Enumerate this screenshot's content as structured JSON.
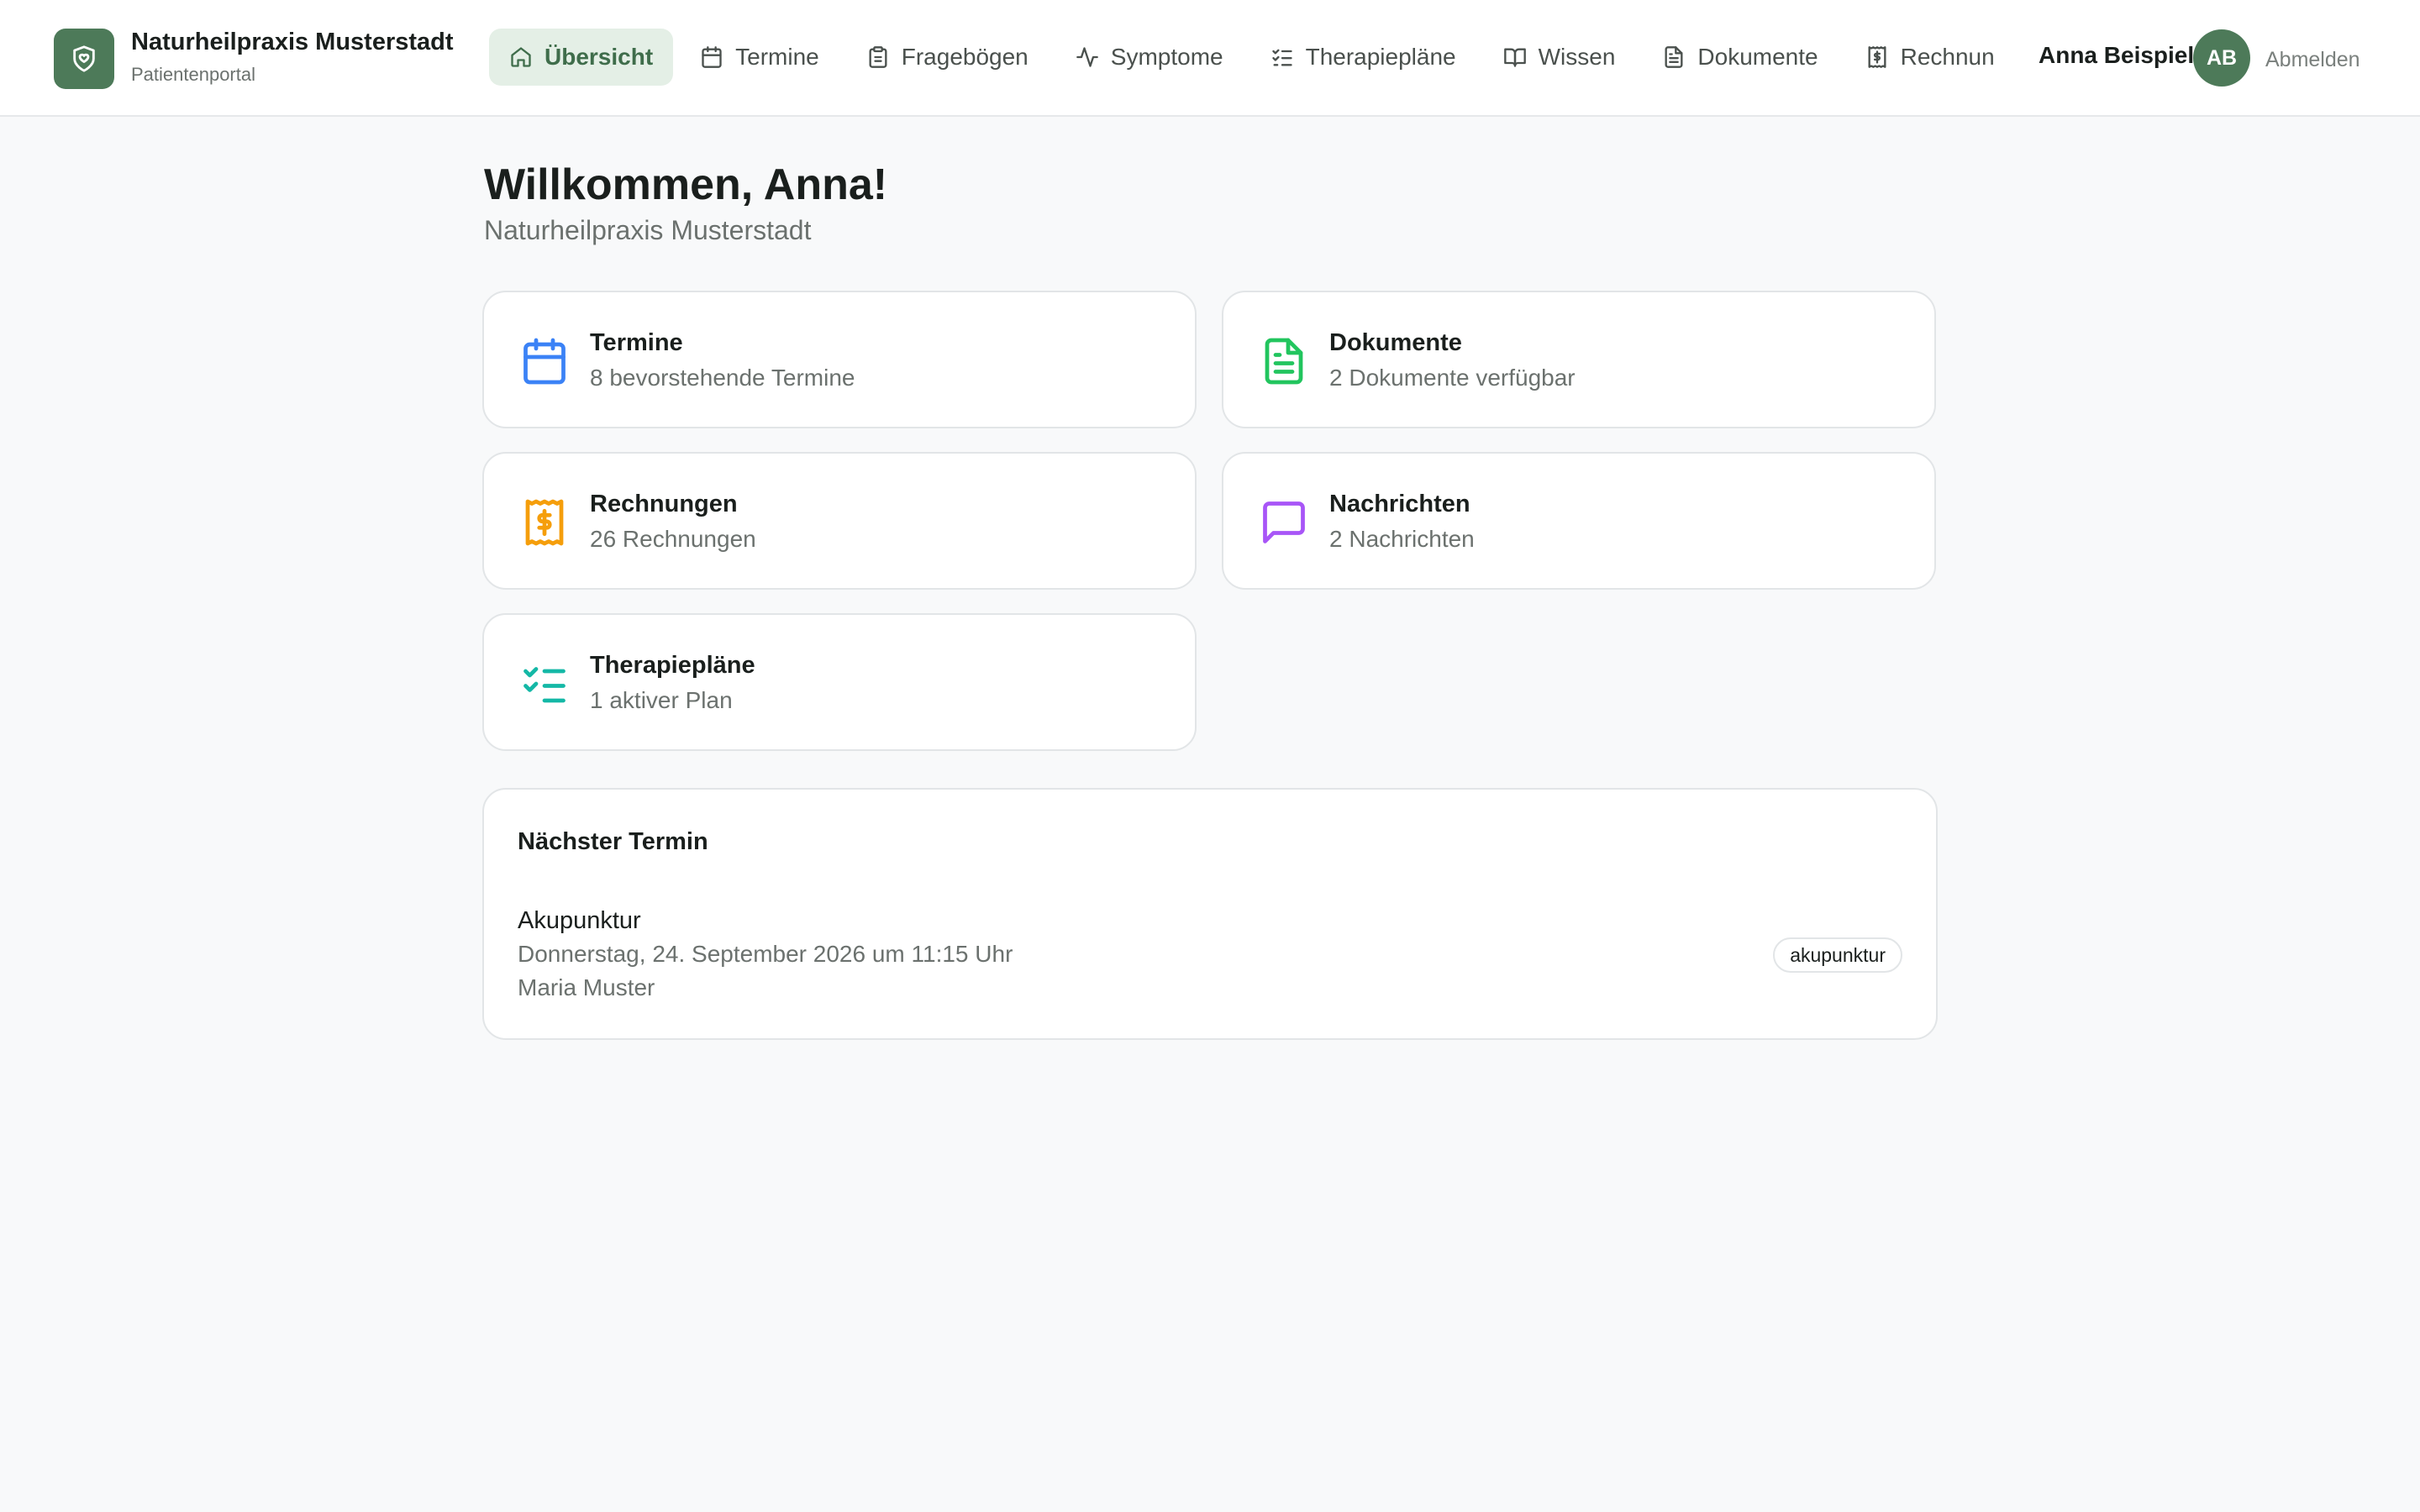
{
  "brand": {
    "name": "Naturheilpraxis Musterstadt",
    "subtitle": "Patientenportal"
  },
  "nav": {
    "items": [
      {
        "label": "Übersicht",
        "icon": "home-icon",
        "active": true
      },
      {
        "label": "Termine",
        "icon": "calendar-icon"
      },
      {
        "label": "Fragebögen",
        "icon": "clipboard-icon"
      },
      {
        "label": "Symptome",
        "icon": "activity-icon"
      },
      {
        "label": "Therapiepläne",
        "icon": "list-check-icon"
      },
      {
        "label": "Wissen",
        "icon": "book-open-icon"
      },
      {
        "label": "Dokumente",
        "icon": "file-text-icon"
      },
      {
        "label": "Rechnungen",
        "icon": "receipt-icon"
      }
    ]
  },
  "user": {
    "name": "Anna Beispiel",
    "initials": "AB",
    "logout_label": "Abmelden"
  },
  "main": {
    "welcome": "Willkommen, Anna!",
    "practice": "Naturheilpraxis Musterstadt",
    "cards": [
      {
        "title": "Termine",
        "subtitle": "8 bevorstehende Termine",
        "icon": "calendar-icon",
        "color": "#3b82f6"
      },
      {
        "title": "Dokumente",
        "subtitle": "2 Dokumente verfügbar",
        "icon": "file-text-icon",
        "color": "#22c55e"
      },
      {
        "title": "Rechnungen",
        "subtitle": "26 Rechnungen",
        "icon": "receipt-icon",
        "color": "#f59e0b"
      },
      {
        "title": "Nachrichten",
        "subtitle": "2 Nachrichten",
        "icon": "message-square-icon",
        "color": "#a855f7"
      },
      {
        "title": "Therapiepläne",
        "subtitle": "1 aktiver Plan",
        "icon": "list-check-icon",
        "color": "#14b8a6"
      }
    ],
    "next_appointment": {
      "heading": "Nächster Termin",
      "type": "Akupunktur",
      "datetime": "Donnerstag, 24. September 2026 um 11:15 Uhr",
      "practitioner": "Maria Muster",
      "badge": "akupunktur"
    }
  },
  "colors": {
    "brand": "#4d7a59",
    "active_nav_bg": "#e4efe6",
    "active_nav_text": "#3f6d4b",
    "background": "#f8f9fa"
  }
}
